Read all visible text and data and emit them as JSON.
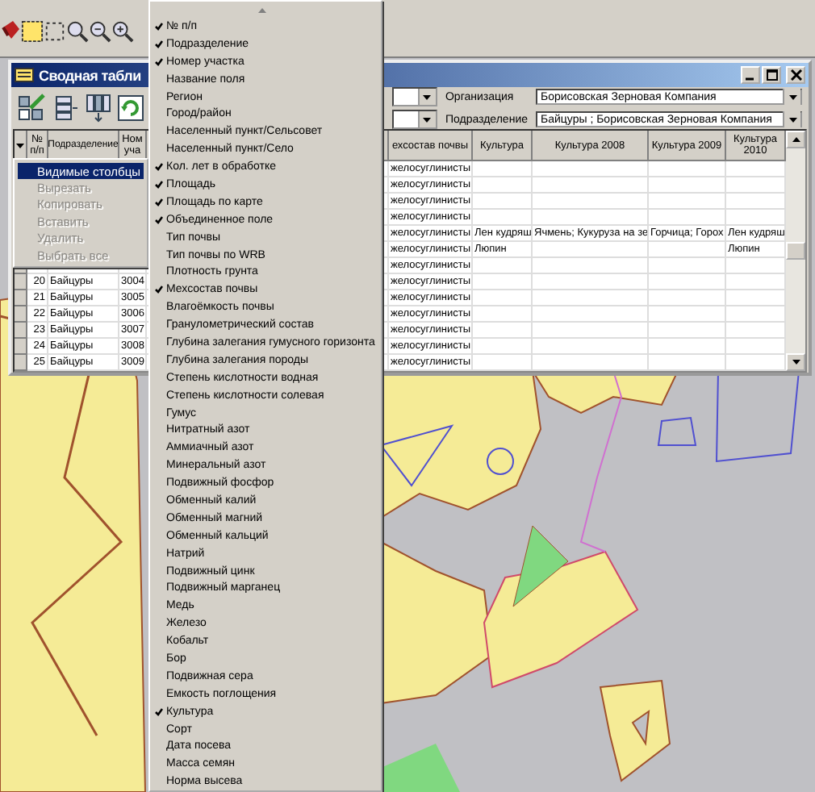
{
  "window": {
    "title": "Сводная табли"
  },
  "filters": [
    {
      "label": "Организация",
      "value": "Борисовская Зерновая Компания"
    },
    {
      "label": "Подразделение",
      "value": "Байцуры ; Борисовская Зерновая Компания"
    }
  ],
  "table": {
    "columns": [
      "№ п/п",
      "Подразделение",
      "Ном уча",
      "ехсостав почвы",
      "Культура",
      "Культура 2008",
      "Культура 2009",
      "Культура 2010"
    ],
    "rows": [
      {
        "soil": "желосуглинисты"
      },
      {
        "soil": "желосуглинисты"
      },
      {
        "soil": "желосуглинисты"
      },
      {
        "soil": "желосуглинисты"
      },
      {
        "soil": "желосуглинисты",
        "culture": "Лен кудряш",
        "culture_2008": "Ячмень; Кукуруза на зе",
        "culture_2009": "Горчица; Горох",
        "culture_2010": "Лен кудряш"
      },
      {
        "soil": "желосуглинисты",
        "culture": "Люпин",
        "culture_2010": "Люпин"
      },
      {
        "soil": "желосуглинисты"
      },
      {
        "number": "20",
        "division": "Байцуры",
        "plot": "3004",
        "soil": "желосуглинисты"
      },
      {
        "number": "21",
        "division": "Байцуры",
        "plot": "3005",
        "soil": "желосуглинисты"
      },
      {
        "number": "22",
        "division": "Байцуры",
        "plot": "3006",
        "soil": "желосуглинисты"
      },
      {
        "number": "23",
        "division": "Байцуры",
        "plot": "3007",
        "soil": "желосуглинисты"
      },
      {
        "number": "24",
        "division": "Байцуры",
        "plot": "3008",
        "soil": "желосуглинисты"
      },
      {
        "number": "25",
        "division": "Байцуры",
        "plot": "3009",
        "soil": "желосуглинисты"
      }
    ]
  },
  "context_menu": {
    "items": [
      {
        "label": "Видимые столбцы",
        "selected": true,
        "disabled": false,
        "submenu": true
      },
      {
        "label": "Вырезать",
        "selected": false,
        "disabled": true,
        "submenu": false
      },
      {
        "label": "Копировать",
        "selected": false,
        "disabled": true,
        "submenu": false
      },
      {
        "label": "Вставить",
        "selected": false,
        "disabled": true,
        "submenu": false
      },
      {
        "label": "Удалить",
        "selected": false,
        "disabled": true,
        "submenu": false
      },
      {
        "label": "Выбрать все",
        "selected": false,
        "disabled": true,
        "submenu": false
      }
    ]
  },
  "columns_menu": {
    "items": [
      {
        "label": "№ п/п",
        "checked": true
      },
      {
        "label": "Подразделение",
        "checked": true
      },
      {
        "label": "Номер участка",
        "checked": true
      },
      {
        "label": "Название поля",
        "checked": false
      },
      {
        "label": "Регион",
        "checked": false
      },
      {
        "label": "Город/район",
        "checked": false
      },
      {
        "label": "Населенный пункт/Сельсовет",
        "checked": false
      },
      {
        "label": "Населенный пункт/Село",
        "checked": false
      },
      {
        "label": "Кол. лет в обработке",
        "checked": true
      },
      {
        "label": "Площадь",
        "checked": true
      },
      {
        "label": "Площадь по карте",
        "checked": true
      },
      {
        "label": "Объединенное поле",
        "checked": true
      },
      {
        "label": "Тип почвы",
        "checked": false
      },
      {
        "label": "Тип почвы по WRB",
        "checked": false
      },
      {
        "label": "Плотность грунта",
        "checked": false
      },
      {
        "label": "Мехсостав почвы",
        "checked": true
      },
      {
        "label": "Влагоёмкость почвы",
        "checked": false
      },
      {
        "label": "Гранулометрический состав",
        "checked": false
      },
      {
        "label": "Глубина залегания гумусного горизонта",
        "checked": false
      },
      {
        "label": "Глубина залегания породы",
        "checked": false
      },
      {
        "label": "Степень кислотности водная",
        "checked": false
      },
      {
        "label": "Степень кислотности солевая",
        "checked": false
      },
      {
        "label": "Гумус",
        "checked": false
      },
      {
        "label": "Нитратный азот",
        "checked": false
      },
      {
        "label": "Аммиачный азот",
        "checked": false
      },
      {
        "label": "Минеральный азот",
        "checked": false
      },
      {
        "label": "Подвижный фосфор",
        "checked": false
      },
      {
        "label": "Обменный калий",
        "checked": false
      },
      {
        "label": "Обменный магний",
        "checked": false
      },
      {
        "label": "Обменный кальций",
        "checked": false
      },
      {
        "label": "Натрий",
        "checked": false
      },
      {
        "label": "Подвижный цинк",
        "checked": false
      },
      {
        "label": "Подвижный марганец",
        "checked": false
      },
      {
        "label": "Медь",
        "checked": false
      },
      {
        "label": "Железо",
        "checked": false
      },
      {
        "label": "Кобальт",
        "checked": false
      },
      {
        "label": "Бор",
        "checked": false
      },
      {
        "label": "Подвижная сера",
        "checked": false
      },
      {
        "label": "Емкость поглощения",
        "checked": false
      },
      {
        "label": "Культура",
        "checked": true
      },
      {
        "label": "Сорт",
        "checked": false
      },
      {
        "label": "Дата посева",
        "checked": false
      },
      {
        "label": "Масса семян",
        "checked": false
      },
      {
        "label": "Норма высева",
        "checked": false
      }
    ]
  }
}
